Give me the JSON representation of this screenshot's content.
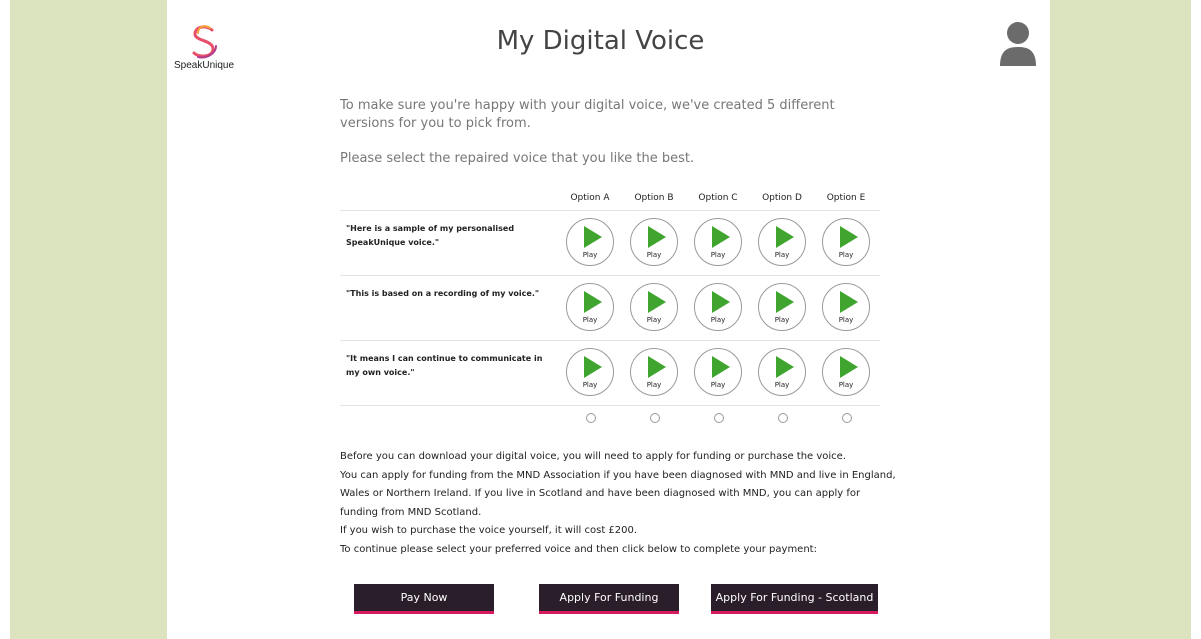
{
  "brand": {
    "name": "SpeakUnique"
  },
  "header": {
    "title": "My Digital Voice"
  },
  "intro": {
    "text": "To make sure you're happy with your digital voice, we've created 5 different versions for you to pick from.",
    "instruction": "Please select the repaired voice that you like the best."
  },
  "voice_table": {
    "options": [
      "Option A",
      "Option B",
      "Option C",
      "Option D",
      "Option E"
    ],
    "play_label": "Play",
    "phrases": [
      "\"Here is a sample of my personalised SpeakUnique voice.\"",
      "\"This is based on a recording of my voice.\"",
      "\"It means I can continue to communicate in my own voice.\""
    ],
    "selected_option": null
  },
  "info": {
    "lines": [
      "Before you can download your digital voice, you will need to apply for funding or purchase the voice.",
      "You can apply for funding from the MND Association if you have been diagnosed with MND and live in England, Wales or Northern Ireland. If you live in Scotland and have been diagnosed with MND, you can apply for funding from MND Scotland.",
      "If you wish to purchase the voice yourself, it will cost £200.",
      "To continue please select your preferred voice and then click below to complete your payment:"
    ]
  },
  "actions": {
    "pay_now": "Pay Now",
    "apply_funding": "Apply For Funding",
    "apply_funding_scotland": "Apply For Funding - Scotland"
  },
  "colors": {
    "side_panel": "#dbe3bf",
    "play_green": "#3fa52f",
    "button_bg": "#2b1e2b",
    "button_accent": "#d81b60"
  }
}
